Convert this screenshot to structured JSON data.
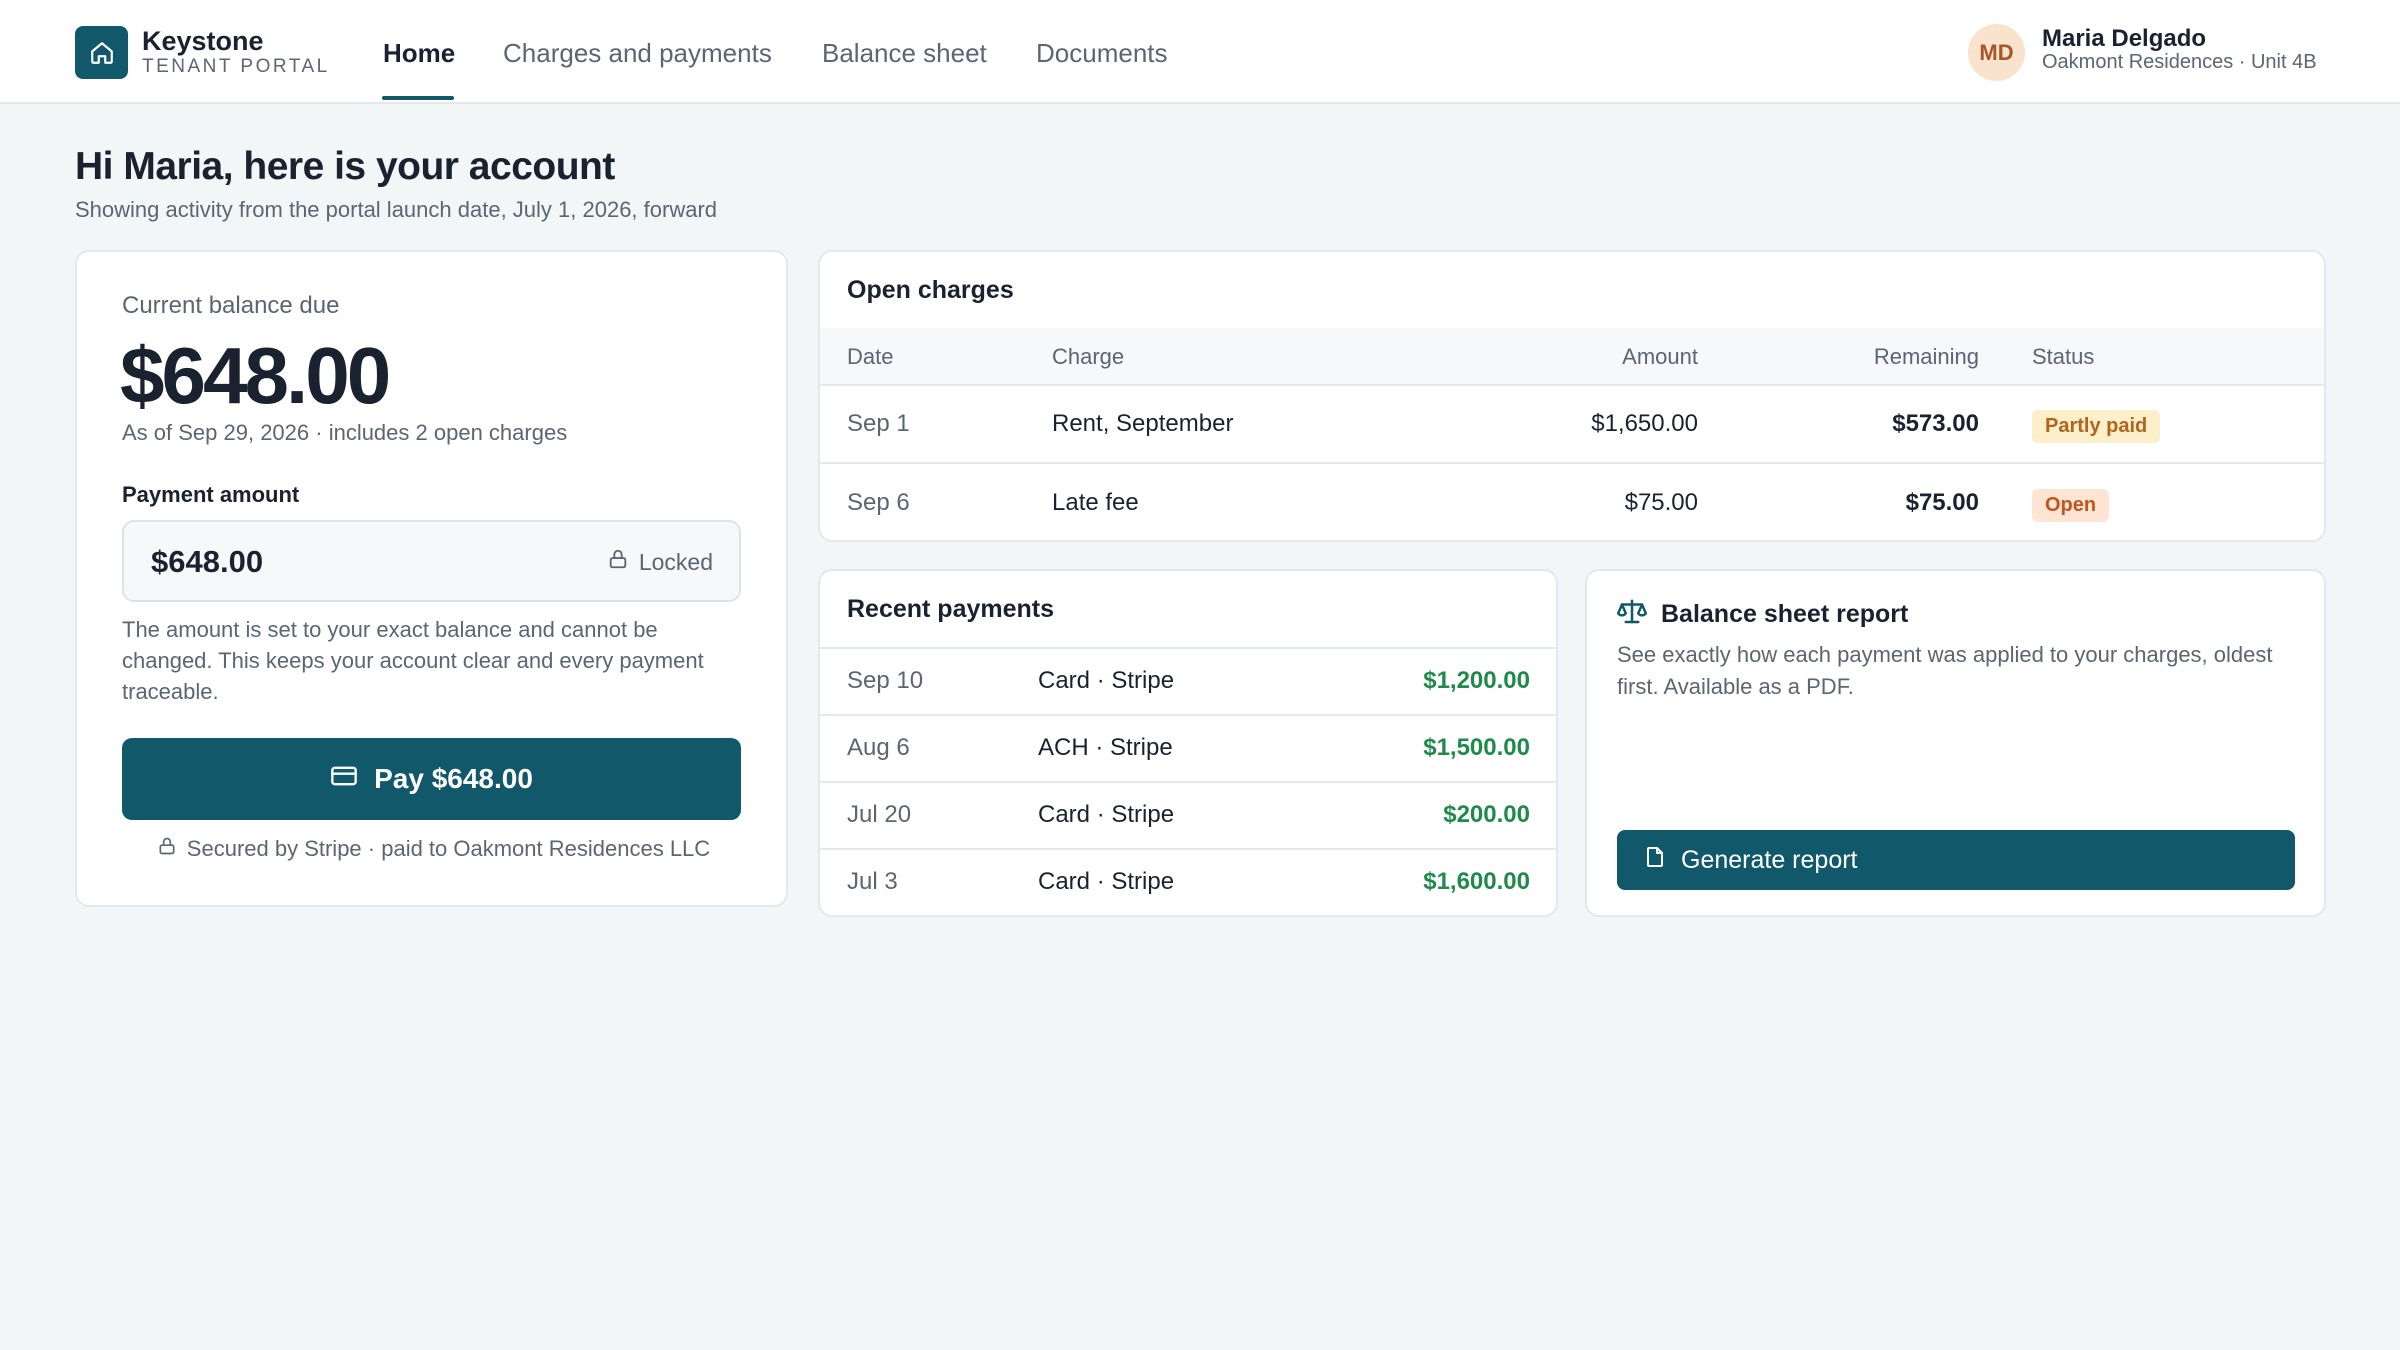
{
  "brand": {
    "name": "Keystone",
    "subtitle": "TENANT PORTAL",
    "logo_icon": "home-icon",
    "accent_color": "#11586b"
  },
  "nav": {
    "tabs": [
      {
        "label": "Home",
        "active": true
      },
      {
        "label": "Charges and payments",
        "active": false
      },
      {
        "label": "Balance sheet",
        "active": false
      },
      {
        "label": "Documents",
        "active": false
      }
    ]
  },
  "user": {
    "initials": "MD",
    "name": "Maria Delgado",
    "property": "Oakmont Residences · Unit 4B"
  },
  "greeting": {
    "title": "Hi Maria, here is your account",
    "subtitle": "Showing activity from the portal launch date, July 1, 2026, forward"
  },
  "balance": {
    "label": "Current balance due",
    "amount": "$648.00",
    "as_of": "As of Sep 29, 2026 · includes 2 open charges",
    "payment_label": "Payment amount",
    "payment_value": "$648.00",
    "locked_label": "Locked",
    "note": "The amount is set to your exact balance and cannot be changed. This keeps your account clear and every payment traceable.",
    "pay_button": "Pay $648.00",
    "secured": "Secured by Stripe · paid to Oakmont Residences LLC"
  },
  "open_charges": {
    "title": "Open charges",
    "headers": {
      "date": "Date",
      "charge": "Charge",
      "amount": "Amount",
      "remaining": "Remaining",
      "status": "Status"
    },
    "rows": [
      {
        "date": "Sep 1",
        "charge": "Rent, September",
        "amount": "$1,650.00",
        "remaining": "$573.00",
        "status": "Partly paid"
      },
      {
        "date": "Sep 6",
        "charge": "Late fee",
        "amount": "$75.00",
        "remaining": "$75.00",
        "status": "Open"
      }
    ]
  },
  "recent_payments": {
    "title": "Recent payments",
    "rows": [
      {
        "date": "Sep 10",
        "method": "Card · Stripe",
        "amount": "$1,200.00"
      },
      {
        "date": "Aug 6",
        "method": "ACH · Stripe",
        "amount": "$1,500.00"
      },
      {
        "date": "Jul 20",
        "method": "Card · Stripe",
        "amount": "$200.00"
      },
      {
        "date": "Jul 3",
        "method": "Card · Stripe",
        "amount": "$1,600.00"
      }
    ]
  },
  "report": {
    "title": "Balance sheet report",
    "description": "See exactly how each payment was applied to your charges, oldest first. Available as a PDF.",
    "button": "Generate report",
    "icon": "scale-icon"
  }
}
